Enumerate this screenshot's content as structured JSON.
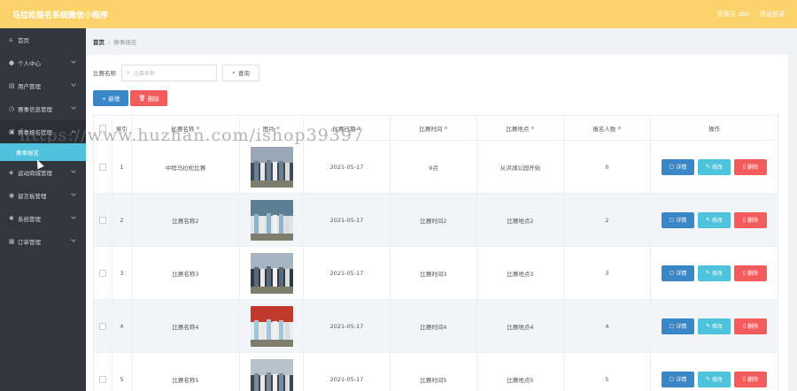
{
  "header": {
    "title": "马拉松报名系统微信小程序",
    "admin_label": "管理员 abo",
    "logout_label": "退出登录",
    "bg_color": "#fbd36a"
  },
  "sidebar": {
    "items": [
      {
        "icon": "home-icon",
        "label": "首页"
      },
      {
        "icon": "user-icon",
        "label": "个人中心"
      },
      {
        "icon": "users-icon",
        "label": "用户管理"
      },
      {
        "icon": "info-icon",
        "label": "赛事信息管理"
      },
      {
        "icon": "edit-icon",
        "label": "赛事报名管理"
      },
      {
        "icon": "store-icon",
        "label": "运动商城管理"
      },
      {
        "icon": "message-icon",
        "label": "留言板管理"
      },
      {
        "icon": "gear-icon",
        "label": "系统管理"
      },
      {
        "icon": "list-icon",
        "label": "订单管理"
      }
    ],
    "open_submenu": {
      "label": "赛事报名"
    }
  },
  "breadcrumb": {
    "home": "首页",
    "separator": "/",
    "current": "赛事报名"
  },
  "search": {
    "label": "比赛名称",
    "placeholder": "比赛名称",
    "button": "查询"
  },
  "actions": {
    "add": "+ 新增",
    "delete": "删除"
  },
  "table": {
    "headers": [
      "索引",
      "比赛名称",
      "图片",
      "比赛日期",
      "比赛时间",
      "比赛地点",
      "报名人数",
      "操作"
    ],
    "rows": [
      {
        "index": "1",
        "name": "中程马拉松比赛",
        "date": "2021-05-17",
        "time": "9点",
        "place": "从洪湖公园开始",
        "count": "0"
      },
      {
        "index": "2",
        "name": "比赛名称2",
        "date": "2021-05-17",
        "time": "比赛时间2",
        "place": "比赛地点2",
        "count": "2"
      },
      {
        "index": "3",
        "name": "比赛名称3",
        "date": "2021-05-17",
        "time": "比赛时间3",
        "place": "比赛地点3",
        "count": "3"
      },
      {
        "index": "4",
        "name": "比赛名称4",
        "date": "2021-05-17",
        "time": "比赛时间4",
        "place": "比赛地点4",
        "count": "4"
      },
      {
        "index": "5",
        "name": "比赛名称5",
        "date": "2021-05-17",
        "time": "比赛时间5",
        "place": "比赛地点5",
        "count": "5"
      }
    ],
    "row_actions": {
      "detail": "详情",
      "edit": "修改",
      "delete": "删除"
    }
  },
  "watermark": "https://www.huzhan.com/ishop39397",
  "colors": {
    "primary": "#3a87c8",
    "info": "#4fc2dc",
    "danger": "#f35c5c",
    "sidebar": "#32373f"
  }
}
